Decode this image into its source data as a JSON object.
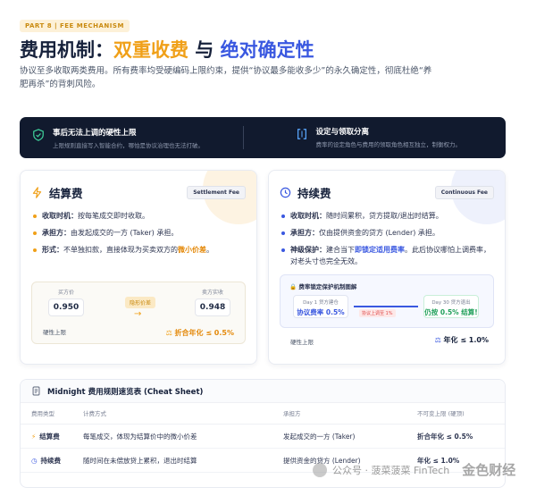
{
  "header": {
    "part_tag": "PART 8 | FEE MECHANISM",
    "title_a": "费用机制：",
    "title_b": "双重收费",
    "title_c": " 与 ",
    "title_d": "绝对确定性",
    "intro": "协议至多收取两类费用。所有费率均受硬编码上限约束，提供“协议最多能收多少”的永久确定性，彻底杜绝“养肥再杀”的背刺风险。"
  },
  "banner": {
    "left_title": "事后无法上调的硬性上限",
    "left_sub": "上限规则直接写入智能合约，哪怕是协议治理也无法打破。",
    "right_title": "设定与领取分离",
    "right_sub": "费率的设定角色与费用的领取角色相互独立，制衡权力。",
    "left_icon": "shield-check-icon",
    "right_icon": "split-brackets-icon"
  },
  "settlement": {
    "title": "结算费",
    "pill": "Settlement Fee",
    "icon": "lightning-icon",
    "b1_label": "收取时机：",
    "b1_text": "按每笔成交即时收取。",
    "b2_label": "承担方：",
    "b2_text": "由发起成交的一方 (Taker) 承担。",
    "b3_label": "形式：",
    "b3_text": "不单独扣款，直接体现为买卖双方的",
    "b3_em": "微小价差",
    "b3_tail": "。",
    "buyer_label": "买方价",
    "buyer_price": "0.950",
    "mid_tag": "隐形价差",
    "seller_label": "卖方实收",
    "seller_price": "0.948",
    "foot_left": "硬性上限",
    "foot_right": "折合年化 ≤ 0.5%"
  },
  "continuous": {
    "title": "持续费",
    "pill": "Continuous Fee",
    "icon": "clock-icon",
    "b1_label": "收取时机：",
    "b1_text": "随时间累积，贷方提取/退出时结算。",
    "b2_label": "承担方：",
    "b2_text": "仅由提供资金的贷方 (Lender) 承担。",
    "b3_label": "神级保护：",
    "b3_pre": "建合当下",
    "b3_em": "即锁定适用费率",
    "b3_tail": "。此后协议哪怕上调费率，对老头寸也完全无效。",
    "diagram_title": "费率锁定保护机制图解",
    "day1_label": "Day 1 贷方建仓",
    "day1_val": "协议费率 0.5%",
    "line_tag": "协议上调至 1%",
    "day30_label": "Day 30 贷方退出",
    "day30_val": "仍按 0.5% 结算!",
    "foot_left": "硬性上限",
    "foot_right": "年化 ≤ 1.0%"
  },
  "sheet": {
    "title": "Midnight 费用规则速览表 (Cheat Sheet)",
    "headers": [
      "费用类型",
      "计费方式",
      "承担方",
      "不可变上限 (硬顶)"
    ],
    "rows": [
      {
        "name": "结算费",
        "method": "每笔成交，体现为结算价中的微小价差",
        "payer": "发起成交的一方 (Taker)",
        "cap": "折合年化 ≤ 0.5%"
      },
      {
        "name": "持续费",
        "method": "随时间在未偿放贷上累积，退出时结算",
        "payer": "提供资金的贷方 (Lender)",
        "cap": "年化 ≤ 1.0%"
      }
    ]
  },
  "watermark": {
    "text": "公众号 · 菠菜菠菜 FinTech",
    "brand": "金色财经"
  },
  "colors": {
    "orange": "#f0a018",
    "blue": "#3a58e0",
    "dark": "#111a2e"
  }
}
